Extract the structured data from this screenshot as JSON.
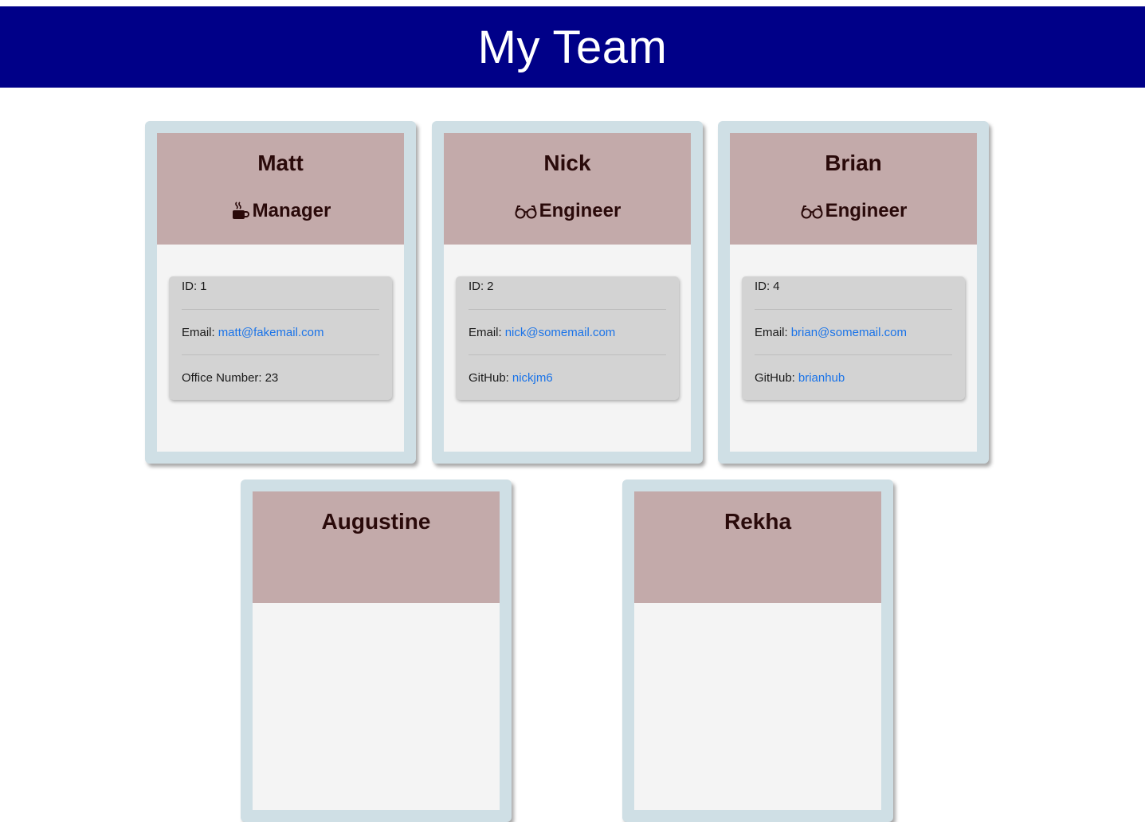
{
  "header": {
    "title": "My Team"
  },
  "cards": [
    {
      "name": "Matt",
      "role": "Manager",
      "role_icon": "coffee-icon",
      "id_label": "ID:",
      "id": "1",
      "email_label": "Email:",
      "email": "matt@fakemail.com",
      "extra_label": "Office Number:",
      "extra": "23"
    },
    {
      "name": "Nick",
      "role": "Engineer",
      "role_icon": "glasses-icon",
      "id_label": "ID:",
      "id": "2",
      "email_label": "Email:",
      "email": "nick@somemail.com",
      "extra_label": "GitHub:",
      "extra": "nickjm6"
    },
    {
      "name": "Brian",
      "role": "Engineer",
      "role_icon": "glasses-icon",
      "id_label": "ID:",
      "id": "4",
      "email_label": "Email:",
      "email": "brian@somemail.com",
      "extra_label": "GitHub:",
      "extra": "brianhub"
    },
    {
      "name": "Augustine"
    },
    {
      "name": "Rekha"
    }
  ],
  "colors": {
    "banner": "#000088",
    "card_frame": "#cfdfe5",
    "card_header": "#c3aaaa",
    "link": "#1a73e8"
  }
}
